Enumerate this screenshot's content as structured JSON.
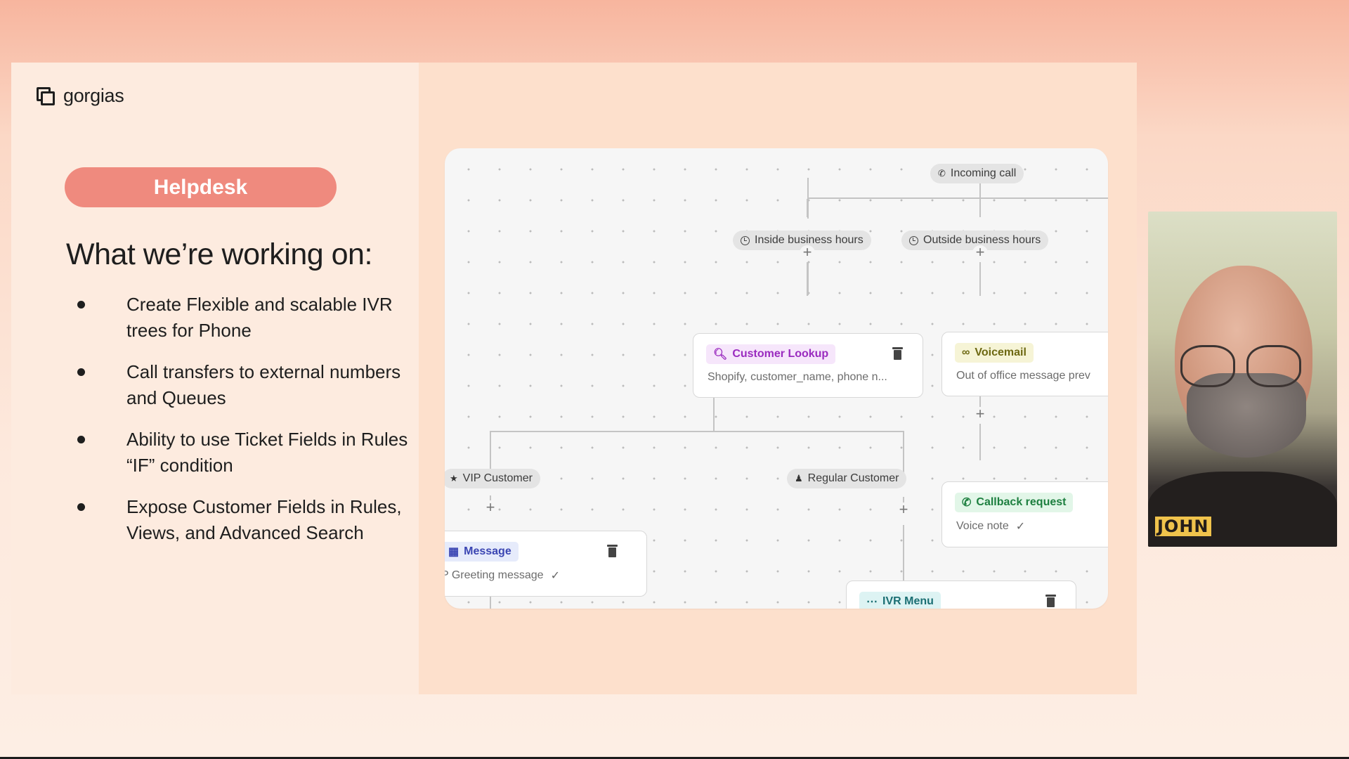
{
  "brand": {
    "name": "gorgias"
  },
  "slide": {
    "pill": "Helpdesk",
    "heading": "What we’re working on:",
    "bullets": [
      "Create Flexible and scalable IVR trees for Phone",
      "Call transfers to external numbers and Queues",
      "Ability to use Ticket Fields in Rules “IF” condition",
      "Expose Customer Fields in Rules, Views, and Advanced Search"
    ]
  },
  "flow": {
    "incoming_call": "Incoming call",
    "inside_hours": "Inside business hours",
    "outside_hours": "Outside business hours",
    "vip_customer": "VIP Customer",
    "regular_customer": "Regular Customer",
    "nodes": {
      "customer_lookup": {
        "title": "Customer Lookup",
        "subtitle": "Shopify, customer_name, phone n..."
      },
      "voicemail": {
        "title": "Voicemail",
        "subtitle": "Out of office message prev"
      },
      "callback": {
        "title": "Callback request",
        "subtitle": "Voice note"
      },
      "message": {
        "title": "Message",
        "subtitle": "P Greeting message"
      },
      "ivr_menu": {
        "title": "IVR Menu"
      }
    },
    "colors": {
      "lookup": "#9a2bbf",
      "voicemail": "#6d6812",
      "callback": "#1d7f3f",
      "message": "#3a45b2",
      "ivr": "#1b6f73"
    }
  },
  "webcam": {
    "name": "JOHN"
  }
}
